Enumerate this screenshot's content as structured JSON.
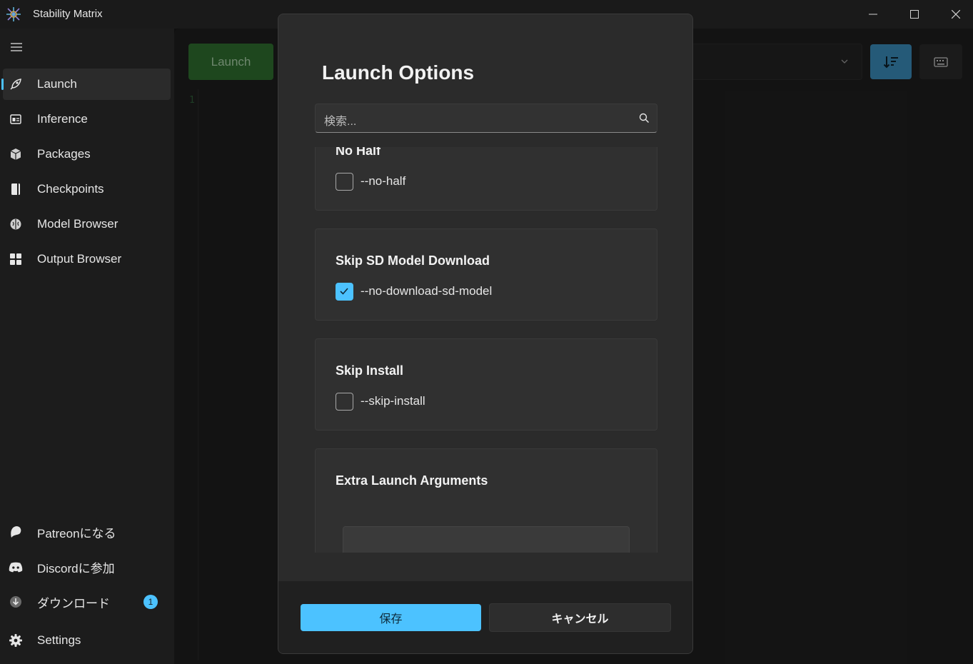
{
  "window": {
    "title": "Stability Matrix"
  },
  "sidebar": {
    "items": [
      {
        "label": "Launch",
        "icon": "rocket-icon"
      },
      {
        "label": "Inference",
        "icon": "inference-icon"
      },
      {
        "label": "Packages",
        "icon": "package-icon"
      },
      {
        "label": "Checkpoints",
        "icon": "notebook-icon"
      },
      {
        "label": "Model Browser",
        "icon": "brain-icon"
      },
      {
        "label": "Output Browser",
        "icon": "grid-icon"
      }
    ],
    "footer_items": [
      {
        "label": "Patreonになる",
        "icon": "patreon-icon"
      },
      {
        "label": "Discordに参加",
        "icon": "discord-icon"
      },
      {
        "label": "ダウンロード",
        "icon": "download-icon",
        "badge": "1"
      },
      {
        "label": "Settings",
        "icon": "gear-icon"
      }
    ]
  },
  "main": {
    "launch_label": "Launch",
    "line_number": "1"
  },
  "dialog": {
    "title": "Launch Options",
    "search_placeholder": "検索...",
    "options": [
      {
        "title": "No Half",
        "flag": "--no-half",
        "checked": false
      },
      {
        "title": "Skip SD Model Download",
        "flag": "--no-download-sd-model",
        "checked": true
      },
      {
        "title": "Skip Install",
        "flag": "--skip-install",
        "checked": false
      }
    ],
    "extra_title": "Extra Launch Arguments",
    "save_label": "保存",
    "cancel_label": "キャンセル"
  },
  "colors": {
    "accent": "#4cc2ff",
    "launch_green": "#2e6e2e",
    "dialog_bg": "#2b2b2b"
  }
}
